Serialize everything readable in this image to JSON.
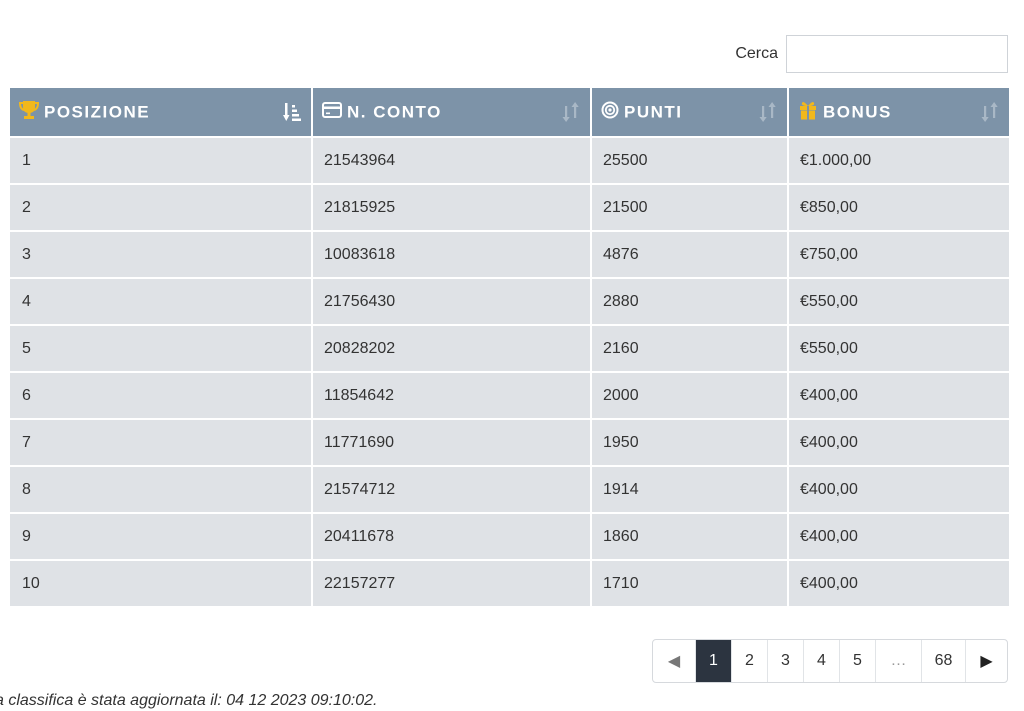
{
  "search": {
    "label": "Cerca",
    "value": "",
    "placeholder": ""
  },
  "table": {
    "headers": [
      {
        "label": "POSIZIONE",
        "icon": "trophy-icon"
      },
      {
        "label": "N. CONTO",
        "icon": "credit-card-icon"
      },
      {
        "label": "PUNTI",
        "icon": "target-icon"
      },
      {
        "label": "BONUS",
        "icon": "gift-icon"
      }
    ],
    "rows": [
      {
        "posizione": "1",
        "conto": "21543964",
        "punti": "25500",
        "bonus": "€1.000,00"
      },
      {
        "posizione": "2",
        "conto": "21815925",
        "punti": "21500",
        "bonus": "€850,00"
      },
      {
        "posizione": "3",
        "conto": "10083618",
        "punti": "4876",
        "bonus": "€750,00"
      },
      {
        "posizione": "4",
        "conto": "21756430",
        "punti": "2880",
        "bonus": "€550,00"
      },
      {
        "posizione": "5",
        "conto": "20828202",
        "punti": "2160",
        "bonus": "€550,00"
      },
      {
        "posizione": "6",
        "conto": "11854642",
        "punti": "2000",
        "bonus": "€400,00"
      },
      {
        "posizione": "7",
        "conto": "11771690",
        "punti": "1950",
        "bonus": "€400,00"
      },
      {
        "posizione": "8",
        "conto": "21574712",
        "punti": "1914",
        "bonus": "€400,00"
      },
      {
        "posizione": "9",
        "conto": "20411678",
        "punti": "1860",
        "bonus": "€400,00"
      },
      {
        "posizione": "10",
        "conto": "22157277",
        "punti": "1710",
        "bonus": "€400,00"
      }
    ]
  },
  "pagination": {
    "prev": "◀",
    "pages": [
      "1",
      "2",
      "3",
      "4",
      "5"
    ],
    "current": "1",
    "ellipsis": "…",
    "last": "68",
    "next": "▶"
  },
  "footnote": "a classifica è stata aggiornata il: 04 12 2023 09:10:02.",
  "colors": {
    "header_bg": "#7d93a8",
    "row_bg": "#dfe2e6",
    "icon_gold": "#f2b81c",
    "active_page": "#2c3440"
  }
}
